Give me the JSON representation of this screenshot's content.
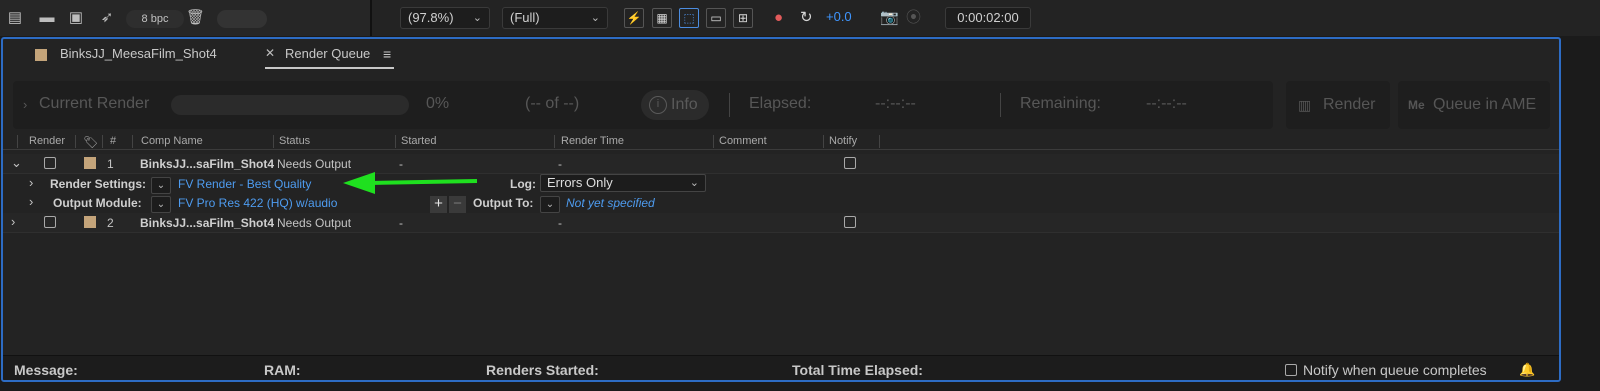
{
  "project_toolbar": {
    "bpc_label": "8 bpc",
    "icons": [
      "interpret-footage-icon",
      "new-folder-icon",
      "new-comp-icon",
      "flowchart-icon",
      "trash-icon"
    ]
  },
  "viewer_toolbar": {
    "zoom": "(97.8%)",
    "resolution": "(Full)",
    "exposure": "+0.0",
    "timecode": "0:00:02:00"
  },
  "tabs": {
    "comp_tab": "BinksJJ_MeesaFilm_Shot4",
    "active_tab": "Render Queue"
  },
  "current_render": {
    "label": "Current Render",
    "progress": "0%",
    "count": "(-- of --)",
    "info_label": "Info",
    "elapsed_label": "Elapsed:",
    "elapsed_value": "--:--:--",
    "remaining_label": "Remaining:",
    "remaining_value": "--:--:--"
  },
  "buttons": {
    "render": "Render",
    "queue_ame": "Queue in AME"
  },
  "columns": {
    "render": "Render",
    "num": "#",
    "comp_name": "Comp Name",
    "status": "Status",
    "started": "Started",
    "render_time": "Render Time",
    "comment": "Comment",
    "notify": "Notify"
  },
  "items": [
    {
      "num": "1",
      "comp_name": "BinksJJ...saFilm_Shot4",
      "status": "Needs Output",
      "started": "-",
      "render_time": "-",
      "render_settings_label": "Render Settings:",
      "render_settings_value": "FV Render - Best Quality",
      "log_label": "Log:",
      "log_value": "Errors Only",
      "output_module_label": "Output Module:",
      "output_module_value": "FV Pro Res 422 (HQ) w/audio",
      "output_to_label": "Output To:",
      "output_to_value": "Not yet specified"
    },
    {
      "num": "2",
      "comp_name": "BinksJJ...saFilm_Shot4",
      "status": "Needs Output",
      "started": "-",
      "render_time": "-"
    }
  ],
  "footer": {
    "message": "Message:",
    "ram": "RAM:",
    "renders_started": "Renders Started:",
    "total_time": "Total Time Elapsed:",
    "notify_label": "Notify when queue completes"
  },
  "colors": {
    "panel_border": "#2d6cc4",
    "link": "#4e9cf0",
    "annotation_arrow": "#1fe01f",
    "label_swatch": "#c4a47a"
  }
}
